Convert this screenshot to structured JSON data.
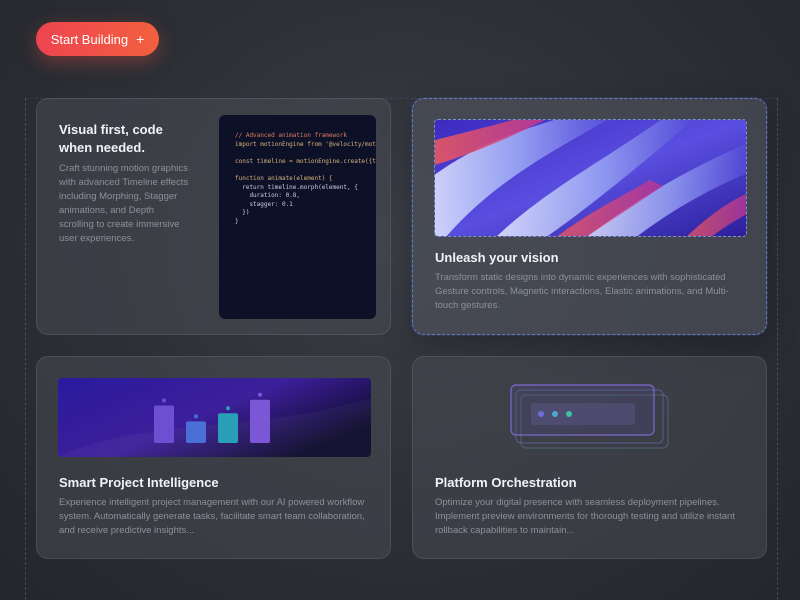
{
  "cta": {
    "label": "Start Building",
    "icon": "plus-icon",
    "glyph": "+"
  },
  "cards": [
    {
      "title": "Visual first, code when needed.",
      "description": "Craft stunning motion graphics with advanced Timeline effects including Morphing, Stagger animations, and Depth scrolling to create immersive user experiences.",
      "code_lines": [
        "// Advanced animation framework",
        "import motionEngine from '@velocity/motion",
        "",
        "const timeline = motionEngine.create({timeli",
        "",
        "function animate(element) {",
        "  return timeline.morph(element, {",
        "    duration: 0.8,",
        "    stagger: 0.1",
        "  })",
        "}"
      ]
    },
    {
      "title": "Unleash your vision",
      "description": "Transform static designs into dynamic experiences with sophisticated Gesture controls, Magnetic interactions, Elastic animations, and Multi-touch gestures."
    },
    {
      "title": "Smart Project Intelligence",
      "description": "Experience intelligent project management with our AI powered workflow system. Automatically generate tasks, facilitate smart team collaboration, and receive predictive insights...",
      "bars": [
        0.78,
        0.45,
        0.62,
        0.9
      ]
    },
    {
      "title": "Platform Orchestration",
      "description": "Optimize your digital presence with seamless deployment pipelines. Implement preview environments for thorough testing and utilize instant rollback capabilities to maintain..."
    }
  ],
  "colors": {
    "accent_start": "#ee4450",
    "accent_end": "#f2603e",
    "selection": "#6e8cf0",
    "bar_colors": [
      "#6d4fd1",
      "#4a6fd6",
      "#2aa0b8",
      "#7b57d6"
    ],
    "dot_colors": [
      "#6f6cd9",
      "#4ea6d0",
      "#3fc1a6"
    ]
  }
}
